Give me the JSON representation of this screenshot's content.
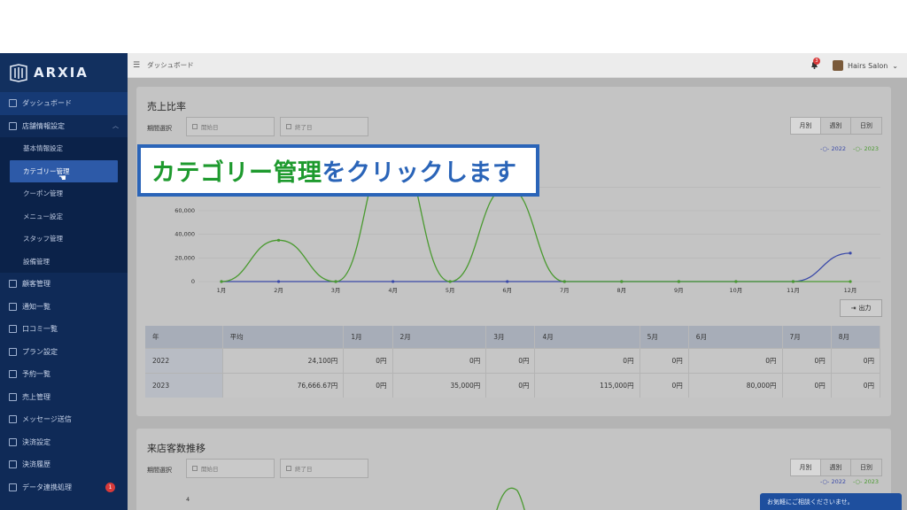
{
  "app": {
    "logo_text": "ARXIA"
  },
  "sidebar": {
    "items": [
      {
        "label": "ダッシュボード"
      },
      {
        "label": "店舗情報設定"
      }
    ],
    "sub_items": [
      {
        "label": "基本情報設定"
      },
      {
        "label": "カテゴリー管理"
      },
      {
        "label": "クーポン管理"
      },
      {
        "label": "メニュー設定"
      },
      {
        "label": "スタッフ管理"
      },
      {
        "label": "設備管理"
      }
    ],
    "items_after": [
      {
        "label": "顧客管理"
      },
      {
        "label": "通知一覧"
      },
      {
        "label": "口コミ一覧"
      },
      {
        "label": "プラン設定"
      },
      {
        "label": "予約一覧"
      },
      {
        "label": "売上管理"
      },
      {
        "label": "メッセージ送信"
      },
      {
        "label": "決済設定"
      },
      {
        "label": "決済履歴"
      },
      {
        "label": "データ連携処理",
        "badge": "1"
      }
    ]
  },
  "topbar": {
    "breadcrumb": "ダッシュボード",
    "notification_count": "3",
    "user_name": "Hairs Salon"
  },
  "sales_card": {
    "title": "売上比率",
    "period_label": "期間選択",
    "start_placeholder": "開始日",
    "end_placeholder": "終了日",
    "tabs": [
      "月別",
      "週別",
      "日別"
    ],
    "legend": [
      "2022",
      "2023"
    ],
    "export_label": "出力",
    "table": {
      "headers": [
        "年",
        "平均",
        "1月",
        "2月",
        "3月",
        "4月",
        "5月",
        "6月",
        "7月",
        "8月"
      ],
      "rows": [
        [
          "2022",
          "24,100円",
          "0円",
          "0円",
          "0円",
          "0円",
          "0円",
          "0円",
          "0円",
          "0円"
        ],
        [
          "2023",
          "76,666.67円",
          "0円",
          "35,000円",
          "0円",
          "115,000円",
          "0円",
          "80,000円",
          "0円",
          "0円"
        ]
      ]
    }
  },
  "visitors_card": {
    "title": "来店客数推移",
    "period_label": "期間選択",
    "start_placeholder": "開始日",
    "end_placeholder": "終了日",
    "tabs": [
      "月別",
      "週別",
      "日別"
    ],
    "legend": [
      "2022",
      "2023"
    ],
    "y_tick_top": "4"
  },
  "callout": {
    "green_text": "カテゴリー管理",
    "blue_text": "をクリックします"
  },
  "chat": {
    "label": "お気軽にご相談くださいませ。"
  },
  "colors": {
    "series_2022": "#3948a8",
    "series_2023": "#4a9a30",
    "callout_border": "#2a64b8"
  },
  "chart_data": {
    "type": "line",
    "categories": [
      "1月",
      "2月",
      "3月",
      "4月",
      "5月",
      "6月",
      "7月",
      "8月",
      "9月",
      "10月",
      "11月",
      "12月"
    ],
    "y_ticks": [
      "0",
      "20,000",
      "40,000",
      "60,000",
      "80,000"
    ],
    "ylim": [
      0,
      120000
    ],
    "series": [
      {
        "name": "2022",
        "values": [
          0,
          0,
          0,
          0,
          0,
          0,
          0,
          0,
          0,
          0,
          0,
          24100
        ]
      },
      {
        "name": "2023",
        "values": [
          0,
          35000,
          0,
          115000,
          0,
          80000,
          0,
          0,
          0,
          0,
          0,
          0
        ]
      }
    ]
  }
}
